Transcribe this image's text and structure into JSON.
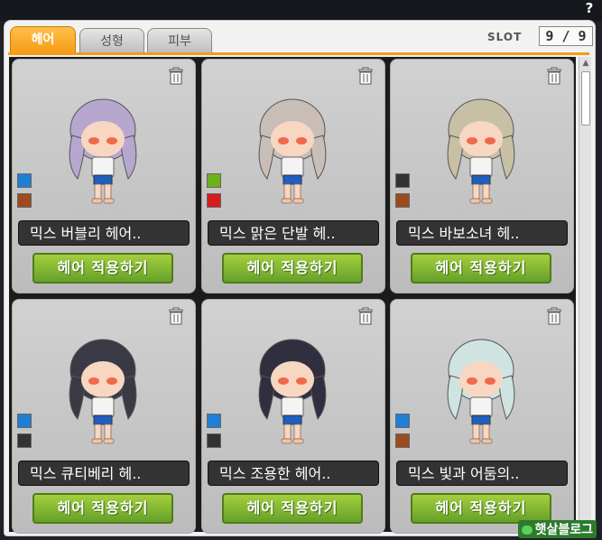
{
  "tabs": [
    {
      "label": "헤어",
      "active": true
    },
    {
      "label": "성형",
      "active": false
    },
    {
      "label": "피부",
      "active": false
    }
  ],
  "slot": {
    "label": "SLOT",
    "value": "9 / 9"
  },
  "help": "?",
  "cards": [
    {
      "name": "믹스 버블리 헤어..",
      "button": "헤어 적용하기",
      "hair_color": "#b7a7cf",
      "swatches": [
        "#1f7fd4",
        "#9c4a1e"
      ]
    },
    {
      "name": "믹스 맑은 단발 헤..",
      "button": "헤어 적용하기",
      "hair_color": "#c9bdb8",
      "swatches": [
        "#6cb21c",
        "#d81b1b"
      ]
    },
    {
      "name": "믹스 바보소녀 헤..",
      "button": "헤어 적용하기",
      "hair_color": "#c8c0a4",
      "swatches": [
        "#333333",
        "#9c4a1e"
      ]
    },
    {
      "name": "믹스 큐티베리 헤..",
      "button": "헤어 적용하기",
      "hair_color": "#3a3a46",
      "swatches": [
        "#1f7fd4",
        "#333333"
      ]
    },
    {
      "name": "믹스 조용한 헤어..",
      "button": "헤어 적용하기",
      "hair_color": "#2f2f3f",
      "swatches": [
        "#1f7fd4",
        "#333333"
      ]
    },
    {
      "name": "믹스 빛과 어둠의..",
      "button": "헤어 적용하기",
      "hair_color": "#cfe4e0",
      "swatches": [
        "#1f7fd4",
        "#9c4a1e"
      ]
    }
  ],
  "watermark": "햇살블로그",
  "colors": {
    "accent": "#f59b16",
    "button": "#7cb430"
  }
}
